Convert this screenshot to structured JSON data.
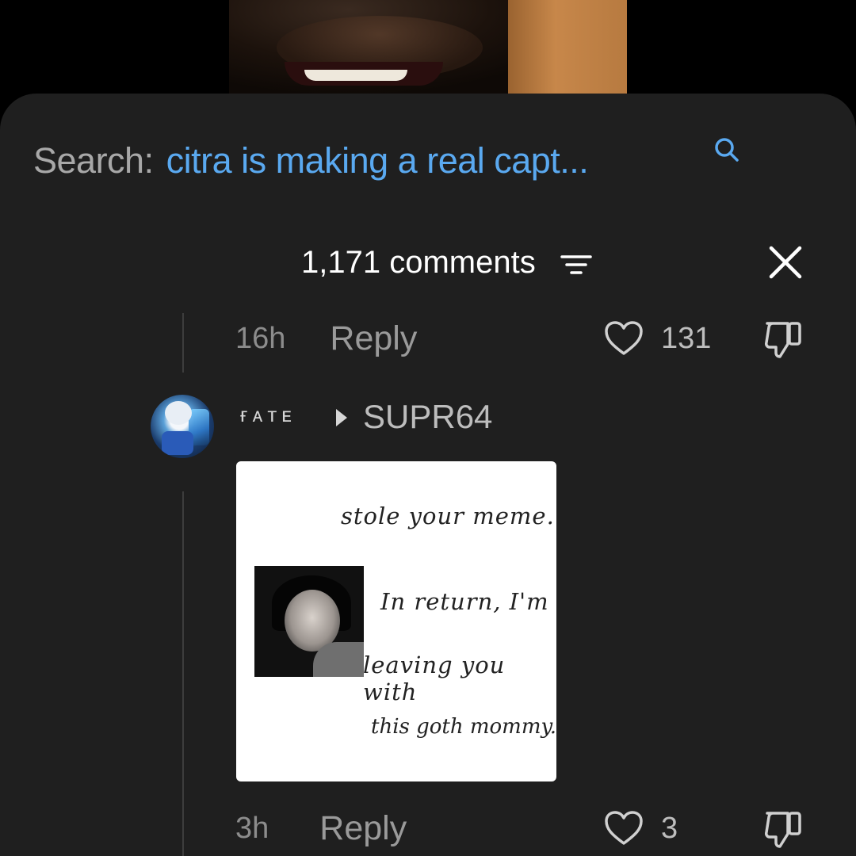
{
  "search": {
    "label": "Search:",
    "query": "citra is making a real capt..."
  },
  "header": {
    "comment_count": "1,171 comments"
  },
  "comments": [
    {
      "time": "16h",
      "reply_label": "Reply",
      "likes": "131"
    },
    {
      "username": "ғᴀᴛᴇ",
      "reply_to": "SUPR64",
      "meme": {
        "line1": "stole your meme.",
        "line2": "In return, I'm",
        "line3": "leaving you with",
        "line4": "this goth mommy."
      },
      "time": "3h",
      "reply_label": "Reply",
      "likes": "3"
    }
  ],
  "colors": {
    "sheet_bg": "#1f1f1f",
    "link_blue": "#5aa9f0",
    "muted_text": "#8c8c8c"
  }
}
